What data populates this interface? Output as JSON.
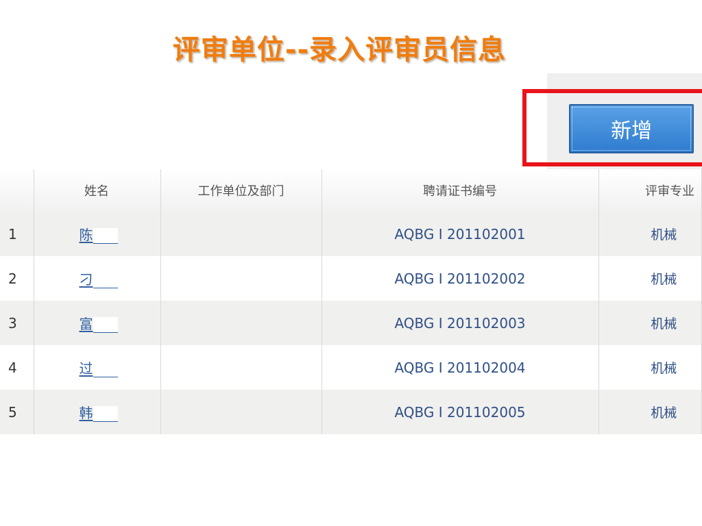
{
  "title": "评审单位--录入评审员信息",
  "toolbar": {
    "add_label": "新增"
  },
  "table": {
    "headers": [
      "",
      "姓名",
      "工作单位及部门",
      "聘请证书编号",
      "评审专业"
    ],
    "rows": [
      {
        "index": "1",
        "name": "陈",
        "unit": "",
        "cert": "AQBG I 201102001",
        "major": "机械"
      },
      {
        "index": "2",
        "name": "刁",
        "unit": "",
        "cert": "AQBG I 201102002",
        "major": "机械"
      },
      {
        "index": "3",
        "name": "富",
        "unit": "",
        "cert": "AQBG I 201102003",
        "major": "机械"
      },
      {
        "index": "4",
        "name": "过",
        "unit": "",
        "cert": "AQBG I 201102004",
        "major": "机械"
      },
      {
        "index": "5",
        "name": "韩",
        "unit": "",
        "cert": "AQBG I 201102005",
        "major": "机械"
      }
    ]
  },
  "colors": {
    "title": "#f07c0f",
    "highlight": "#e8141b",
    "button": "#2f7ccf",
    "link": "#2f5f9f"
  }
}
